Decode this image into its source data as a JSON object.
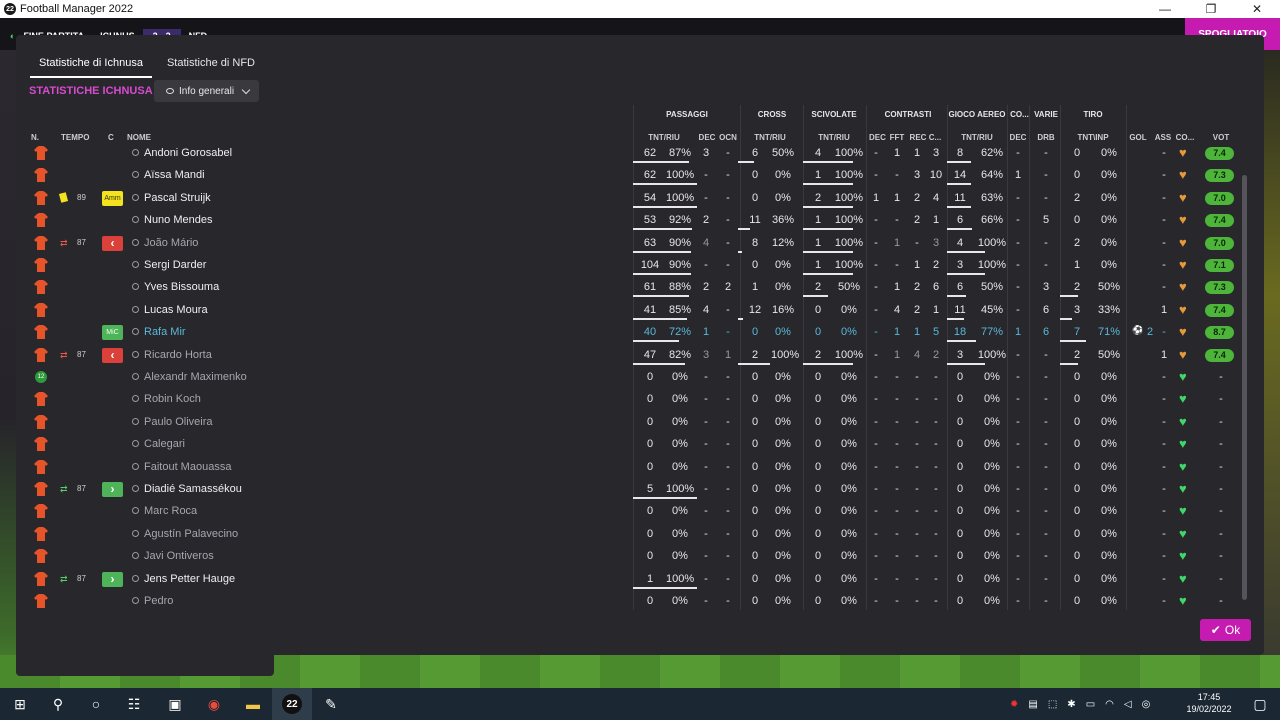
{
  "window": {
    "title": "Football Manager 2022",
    "logo_text": "22",
    "minimize": "—",
    "maximize": "❐",
    "close": "✕"
  },
  "topstrip": {
    "left_text": "FINE PARTITA",
    "team1": "ICHNUS",
    "score": "2 - 2",
    "team2": "NFD",
    "right_button": "SPOGLIATOIO"
  },
  "tabs": [
    {
      "label": "Statistiche di Ichnusa",
      "active": true
    },
    {
      "label": "Statistiche di NFD",
      "active": false
    }
  ],
  "section_title": "STATISTICHE ICHNUSA",
  "dropdown": {
    "label": "Info generali"
  },
  "headers": {
    "groups": [
      "PASSAGGI",
      "CROSS",
      "SCIVOLATE",
      "CONTRASTI",
      "GIOCO AEREO",
      "CO...",
      "VARIE",
      "TIRO"
    ],
    "left": [
      "N.",
      "TEMPO",
      "C",
      "NOME"
    ],
    "sub": [
      "TNT/RIU",
      "DEC",
      "OCN",
      "TNT/RIU",
      "TNT/RIU",
      "DEC",
      "FFT",
      "REC",
      "C...",
      "TNT/RIU",
      "DEC",
      "DRB",
      "TNT\\INP",
      "GOL",
      "ASS",
      "CO...",
      "VOT"
    ]
  },
  "players": [
    {
      "num": "",
      "name": "Andoni Gorosabel",
      "dim": false,
      "pass": "62",
      "passp": "87%",
      "dec": "3",
      "ocn": "-",
      "cr": "6",
      "crp": "50%",
      "sc": "4",
      "scp": "100%",
      "cdec": "-",
      "fft": "1",
      "rec": "1",
      "cc": "3",
      "ga": "8",
      "gap": "62%",
      "co": "-",
      "drb": "-",
      "sh": "0",
      "shp": "0%",
      "gol": "",
      "ass": "-",
      "cond": "orange",
      "vot": "7.4"
    },
    {
      "num": "",
      "name": "Aïssa Mandi",
      "dim": false,
      "pass": "62",
      "passp": "100%",
      "dec": "-",
      "ocn": "-",
      "cr": "0",
      "crp": "0%",
      "sc": "1",
      "scp": "100%",
      "cdec": "-",
      "fft": "-",
      "rec": "3",
      "cc": "10",
      "ga": "14",
      "gap": "64%",
      "co": "1",
      "drb": "-",
      "sh": "0",
      "shp": "0%",
      "gol": "",
      "ass": "-",
      "cond": "orange",
      "vot": "7.3"
    },
    {
      "num": "",
      "name": "Pascal Struijk",
      "dim": false,
      "event": "yellow",
      "minute": "89",
      "badge": "Amm",
      "pass": "54",
      "passp": "100%",
      "dec": "-",
      "ocn": "-",
      "cr": "0",
      "crp": "0%",
      "sc": "2",
      "scp": "100%",
      "cdec": "1",
      "fft": "1",
      "rec": "2",
      "cc": "4",
      "ga": "11",
      "gap": "63%",
      "co": "-",
      "drb": "-",
      "sh": "2",
      "shp": "0%",
      "gol": "",
      "ass": "-",
      "cond": "orange",
      "vot": "7.0"
    },
    {
      "num": "",
      "name": "Nuno Mendes",
      "dim": false,
      "pass": "53",
      "passp": "92%",
      "dec": "2",
      "ocn": "-",
      "cr": "11",
      "crp": "36%",
      "sc": "1",
      "scp": "100%",
      "cdec": "-",
      "fft": "-",
      "rec": "2",
      "cc": "1",
      "ga": "6",
      "gap": "66%",
      "co": "-",
      "drb": "5",
      "sh": "0",
      "shp": "0%",
      "gol": "",
      "ass": "-",
      "cond": "orange",
      "vot": "7.4"
    },
    {
      "num": "",
      "name": "João Mário",
      "dim": true,
      "event": "subout",
      "minute": "87",
      "pass": "63",
      "passp": "90%",
      "dec": "4",
      "ocn": "-",
      "cr": "8",
      "crp": "12%",
      "sc": "1",
      "scp": "100%",
      "cdec": "-",
      "fft": "1",
      "rec": "-",
      "cc": "3",
      "ga": "4",
      "gap": "100%",
      "co": "-",
      "drb": "-",
      "sh": "2",
      "shp": "0%",
      "gol": "",
      "ass": "-",
      "cond": "orange",
      "vot": "7.0"
    },
    {
      "num": "",
      "name": "Sergi Darder",
      "dim": false,
      "pass": "104",
      "passp": "90%",
      "dec": "-",
      "ocn": "-",
      "cr": "0",
      "crp": "0%",
      "sc": "1",
      "scp": "100%",
      "cdec": "-",
      "fft": "-",
      "rec": "1",
      "cc": "2",
      "ga": "3",
      "gap": "100%",
      "co": "-",
      "drb": "-",
      "sh": "1",
      "shp": "0%",
      "gol": "",
      "ass": "-",
      "cond": "orange",
      "vot": "7.1"
    },
    {
      "num": "",
      "name": "Yves Bissouma",
      "dim": false,
      "pass": "61",
      "passp": "88%",
      "dec": "2",
      "ocn": "2",
      "cr": "1",
      "crp": "0%",
      "sc": "2",
      "scp": "50%",
      "cdec": "-",
      "fft": "1",
      "rec": "2",
      "cc": "6",
      "ga": "6",
      "gap": "50%",
      "co": "-",
      "drb": "3",
      "sh": "2",
      "shp": "50%",
      "gol": "",
      "ass": "-",
      "cond": "orange",
      "vot": "7.3"
    },
    {
      "num": "",
      "name": "Lucas Moura",
      "dim": false,
      "pass": "41",
      "passp": "85%",
      "dec": "4",
      "ocn": "-",
      "cr": "12",
      "crp": "16%",
      "sc": "0",
      "scp": "0%",
      "cdec": "-",
      "fft": "4",
      "rec": "2",
      "cc": "1",
      "ga": "11",
      "gap": "45%",
      "co": "-",
      "drb": "6",
      "sh": "3",
      "shp": "33%",
      "gol": "",
      "ass": "1",
      "cond": "orange",
      "vot": "7.4"
    },
    {
      "num": "",
      "name": "Rafa Mir",
      "dim": false,
      "hl": true,
      "badge": "MiC",
      "pass": "40",
      "passp": "72%",
      "dec": "1",
      "ocn": "-",
      "cr": "0",
      "crp": "0%",
      "sc": "0",
      "scp": "0%",
      "cdec": "-",
      "fft": "1",
      "rec": "1",
      "cc": "5",
      "ga": "18",
      "gap": "77%",
      "co": "1",
      "drb": "6",
      "sh": "7",
      "shp": "71%",
      "gol": "2",
      "ass": "-",
      "cond": "orange",
      "vot": "8.7"
    },
    {
      "num": "",
      "name": "Ricardo Horta",
      "dim": true,
      "event": "subout",
      "minute": "87",
      "pass": "47",
      "passp": "82%",
      "dec": "3",
      "ocn": "1",
      "cr": "2",
      "crp": "100%",
      "sc": "2",
      "scp": "100%",
      "cdec": "-",
      "fft": "1",
      "rec": "4",
      "cc": "2",
      "ga": "3",
      "gap": "100%",
      "co": "-",
      "drb": "-",
      "sh": "2",
      "shp": "50%",
      "gol": "",
      "ass": "1",
      "cond": "orange",
      "vot": "7.4"
    },
    {
      "num": "12",
      "name": "Alexandr Maximenko",
      "dim": true,
      "gk": true,
      "pass": "0",
      "passp": "0%",
      "dec": "-",
      "ocn": "-",
      "cr": "0",
      "crp": "0%",
      "sc": "0",
      "scp": "0%",
      "cdec": "-",
      "fft": "-",
      "rec": "-",
      "cc": "-",
      "ga": "0",
      "gap": "0%",
      "co": "-",
      "drb": "-",
      "sh": "0",
      "shp": "0%",
      "gol": "",
      "ass": "-",
      "cond": "green",
      "vot": "-"
    },
    {
      "num": "",
      "name": "Robin Koch",
      "dim": true,
      "pass": "0",
      "passp": "0%",
      "dec": "-",
      "ocn": "-",
      "cr": "0",
      "crp": "0%",
      "sc": "0",
      "scp": "0%",
      "cdec": "-",
      "fft": "-",
      "rec": "-",
      "cc": "-",
      "ga": "0",
      "gap": "0%",
      "co": "-",
      "drb": "-",
      "sh": "0",
      "shp": "0%",
      "gol": "",
      "ass": "-",
      "cond": "green",
      "vot": "-"
    },
    {
      "num": "",
      "name": "Paulo Oliveira",
      "dim": true,
      "pass": "0",
      "passp": "0%",
      "dec": "-",
      "ocn": "-",
      "cr": "0",
      "crp": "0%",
      "sc": "0",
      "scp": "0%",
      "cdec": "-",
      "fft": "-",
      "rec": "-",
      "cc": "-",
      "ga": "0",
      "gap": "0%",
      "co": "-",
      "drb": "-",
      "sh": "0",
      "shp": "0%",
      "gol": "",
      "ass": "-",
      "cond": "green",
      "vot": "-"
    },
    {
      "num": "",
      "name": "Calegari",
      "dim": true,
      "pass": "0",
      "passp": "0%",
      "dec": "-",
      "ocn": "-",
      "cr": "0",
      "crp": "0%",
      "sc": "0",
      "scp": "0%",
      "cdec": "-",
      "fft": "-",
      "rec": "-",
      "cc": "-",
      "ga": "0",
      "gap": "0%",
      "co": "-",
      "drb": "-",
      "sh": "0",
      "shp": "0%",
      "gol": "",
      "ass": "-",
      "cond": "green",
      "vot": "-"
    },
    {
      "num": "",
      "name": "Faitout Maouassa",
      "dim": true,
      "pass": "0",
      "passp": "0%",
      "dec": "-",
      "ocn": "-",
      "cr": "0",
      "crp": "0%",
      "sc": "0",
      "scp": "0%",
      "cdec": "-",
      "fft": "-",
      "rec": "-",
      "cc": "-",
      "ga": "0",
      "gap": "0%",
      "co": "-",
      "drb": "-",
      "sh": "0",
      "shp": "0%",
      "gol": "",
      "ass": "-",
      "cond": "green",
      "vot": "-"
    },
    {
      "num": "",
      "name": "Diadié Samassékou",
      "dim": false,
      "event": "subin",
      "minute": "87",
      "pass": "5",
      "passp": "100%",
      "dec": "-",
      "ocn": "-",
      "cr": "0",
      "crp": "0%",
      "sc": "0",
      "scp": "0%",
      "cdec": "-",
      "fft": "-",
      "rec": "-",
      "cc": "-",
      "ga": "0",
      "gap": "0%",
      "co": "-",
      "drb": "-",
      "sh": "0",
      "shp": "0%",
      "gol": "",
      "ass": "-",
      "cond": "green",
      "vot": "-"
    },
    {
      "num": "",
      "name": "Marc Roca",
      "dim": true,
      "pass": "0",
      "passp": "0%",
      "dec": "-",
      "ocn": "-",
      "cr": "0",
      "crp": "0%",
      "sc": "0",
      "scp": "0%",
      "cdec": "-",
      "fft": "-",
      "rec": "-",
      "cc": "-",
      "ga": "0",
      "gap": "0%",
      "co": "-",
      "drb": "-",
      "sh": "0",
      "shp": "0%",
      "gol": "",
      "ass": "-",
      "cond": "green",
      "vot": "-"
    },
    {
      "num": "",
      "name": "Agustín Palavecino",
      "dim": true,
      "pass": "0",
      "passp": "0%",
      "dec": "-",
      "ocn": "-",
      "cr": "0",
      "crp": "0%",
      "sc": "0",
      "scp": "0%",
      "cdec": "-",
      "fft": "-",
      "rec": "-",
      "cc": "-",
      "ga": "0",
      "gap": "0%",
      "co": "-",
      "drb": "-",
      "sh": "0",
      "shp": "0%",
      "gol": "",
      "ass": "-",
      "cond": "green",
      "vot": "-"
    },
    {
      "num": "",
      "name": "Javi Ontiveros",
      "dim": true,
      "pass": "0",
      "passp": "0%",
      "dec": "-",
      "ocn": "-",
      "cr": "0",
      "crp": "0%",
      "sc": "0",
      "scp": "0%",
      "cdec": "-",
      "fft": "-",
      "rec": "-",
      "cc": "-",
      "ga": "0",
      "gap": "0%",
      "co": "-",
      "drb": "-",
      "sh": "0",
      "shp": "0%",
      "gol": "",
      "ass": "-",
      "cond": "green",
      "vot": "-"
    },
    {
      "num": "",
      "name": "Jens Petter Hauge",
      "dim": false,
      "event": "subin",
      "minute": "87",
      "pass": "1",
      "passp": "100%",
      "dec": "-",
      "ocn": "-",
      "cr": "0",
      "crp": "0%",
      "sc": "0",
      "scp": "0%",
      "cdec": "-",
      "fft": "-",
      "rec": "-",
      "cc": "-",
      "ga": "0",
      "gap": "0%",
      "co": "-",
      "drb": "-",
      "sh": "0",
      "shp": "0%",
      "gol": "",
      "ass": "-",
      "cond": "green",
      "vot": "-"
    },
    {
      "num": "",
      "name": "Pedro",
      "dim": true,
      "pass": "0",
      "passp": "0%",
      "dec": "-",
      "ocn": "-",
      "cr": "0",
      "crp": "0%",
      "sc": "0",
      "scp": "0%",
      "cdec": "-",
      "fft": "-",
      "rec": "-",
      "cc": "-",
      "ga": "0",
      "gap": "0%",
      "co": "-",
      "drb": "-",
      "sh": "0",
      "shp": "0%",
      "gol": "",
      "ass": "-",
      "cond": "green",
      "vot": "-"
    }
  ],
  "ok_button": "Ok",
  "taskbar": {
    "time": "17:45",
    "date": "19/02/2022",
    "fm_icon": "22"
  },
  "colors": {
    "accent": "#c51bb0",
    "rating_green": "#4db53a",
    "heart_green": "#3fd66a",
    "heart_orange": "#e59a3a",
    "sub_out": "#d9413a",
    "sub_in": "#4fb35a",
    "shirt": "#e8542a"
  }
}
